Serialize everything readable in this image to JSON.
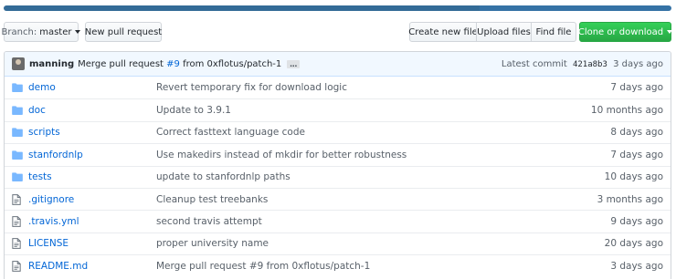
{
  "colors": {
    "folder_icon": "#79b8ff",
    "file_icon": "#6a737d",
    "link": "#0366d6",
    "clone_button": "#28a745"
  },
  "toolbar": {
    "branch_prefix": "Branch:",
    "branch_name": "master",
    "new_pull_request": "New pull request",
    "create_new_file": "Create new file",
    "upload_files": "Upload files",
    "find_file": "Find file",
    "clone_or_download": "Clone or download"
  },
  "commit": {
    "author": "manning",
    "message_prefix": "Merge pull request",
    "pr_number": "#9",
    "message_suffix": "from 0xflotus/patch-1",
    "ellipsis": "…",
    "latest_label": "Latest commit",
    "sha": "421a8b3",
    "age": "3 days ago"
  },
  "files": [
    {
      "type": "folder",
      "icon": "folder-icon",
      "name": "demo",
      "message": "Revert temporary fix for download logic",
      "age": "7 days ago"
    },
    {
      "type": "folder",
      "icon": "folder-icon",
      "name": "doc",
      "message": "Update to 3.9.1",
      "age": "10 months ago"
    },
    {
      "type": "folder",
      "icon": "folder-icon",
      "name": "scripts",
      "message": "Correct fasttext language code",
      "age": "8 days ago"
    },
    {
      "type": "folder",
      "icon": "folder-icon",
      "name": "stanfordnlp",
      "message": "Use makedirs instead of mkdir for better robustness",
      "age": "7 days ago"
    },
    {
      "type": "folder",
      "icon": "folder-icon",
      "name": "tests",
      "message": "update to stanfordnlp paths",
      "age": "10 days ago"
    },
    {
      "type": "file",
      "icon": "file-icon",
      "name": ".gitignore",
      "message": "Cleanup test treebanks",
      "age": "3 months ago"
    },
    {
      "type": "file",
      "icon": "file-icon",
      "name": ".travis.yml",
      "message": "second travis attempt",
      "age": "9 days ago"
    },
    {
      "type": "file",
      "icon": "file-icon",
      "name": "LICENSE",
      "message": "proper university name",
      "age": "20 days ago"
    },
    {
      "type": "file",
      "icon": "file-icon",
      "name": "README.md",
      "message": "Merge pull request #9 from 0xflotus/patch-1",
      "age": "3 days ago"
    }
  ]
}
